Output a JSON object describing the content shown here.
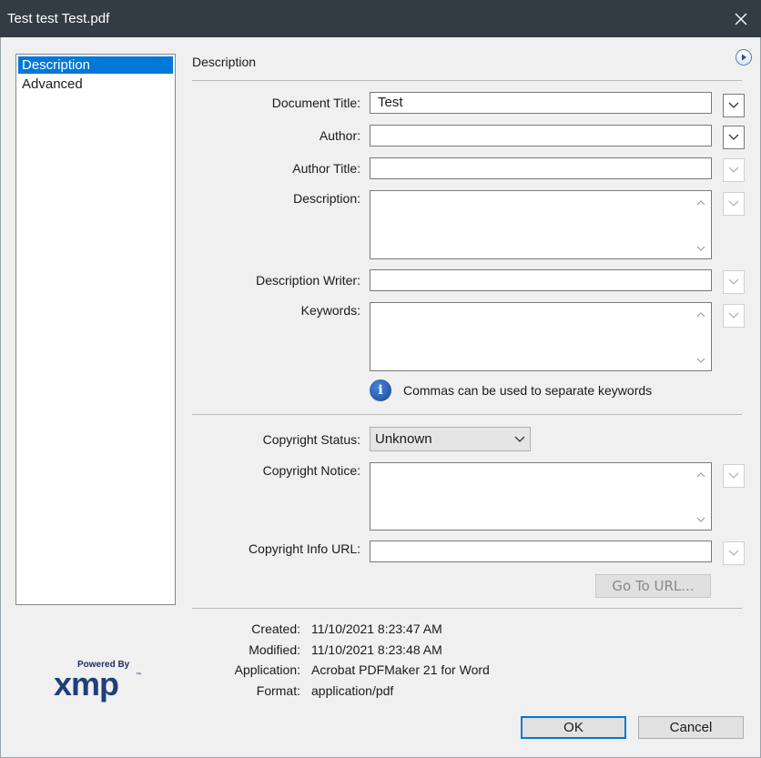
{
  "window": {
    "title": "Test test Test.pdf"
  },
  "sidebar": {
    "items": [
      {
        "label": "Description",
        "selected": true
      },
      {
        "label": "Advanced",
        "selected": false
      }
    ]
  },
  "section": {
    "title": "Description"
  },
  "fields": {
    "document_title": {
      "label": "Document Title:",
      "value": "Test"
    },
    "author": {
      "label": "Author:",
      "value": ""
    },
    "author_title": {
      "label": "Author Title:",
      "value": ""
    },
    "description": {
      "label": "Description:",
      "value": ""
    },
    "description_writer": {
      "label": "Description Writer:",
      "value": ""
    },
    "keywords": {
      "label": "Keywords:",
      "value": ""
    },
    "keywords_hint": "Commas can be used to separate keywords",
    "copyright_status": {
      "label": "Copyright Status:",
      "value": "Unknown"
    },
    "copyright_notice": {
      "label": "Copyright Notice:",
      "value": ""
    },
    "copyright_url": {
      "label": "Copyright Info URL:",
      "value": ""
    },
    "goto_url_label": "Go To URL..."
  },
  "meta": {
    "created": {
      "label": "Created:",
      "value": "11/10/2021 8:23:47 AM"
    },
    "modified": {
      "label": "Modified:",
      "value": "11/10/2021 8:23:48 AM"
    },
    "application": {
      "label": "Application:",
      "value": "Acrobat PDFMaker 21 for Word"
    },
    "format": {
      "label": "Format:",
      "value": "application/pdf"
    }
  },
  "logo": {
    "powered_by": "Powered By",
    "name": "xmp",
    "trademark": "™"
  },
  "buttons": {
    "ok": "OK",
    "cancel": "Cancel"
  },
  "colors": {
    "titlebar": "#333c44",
    "selection": "#0078d7",
    "dialog_bg": "#f0f0f0"
  }
}
